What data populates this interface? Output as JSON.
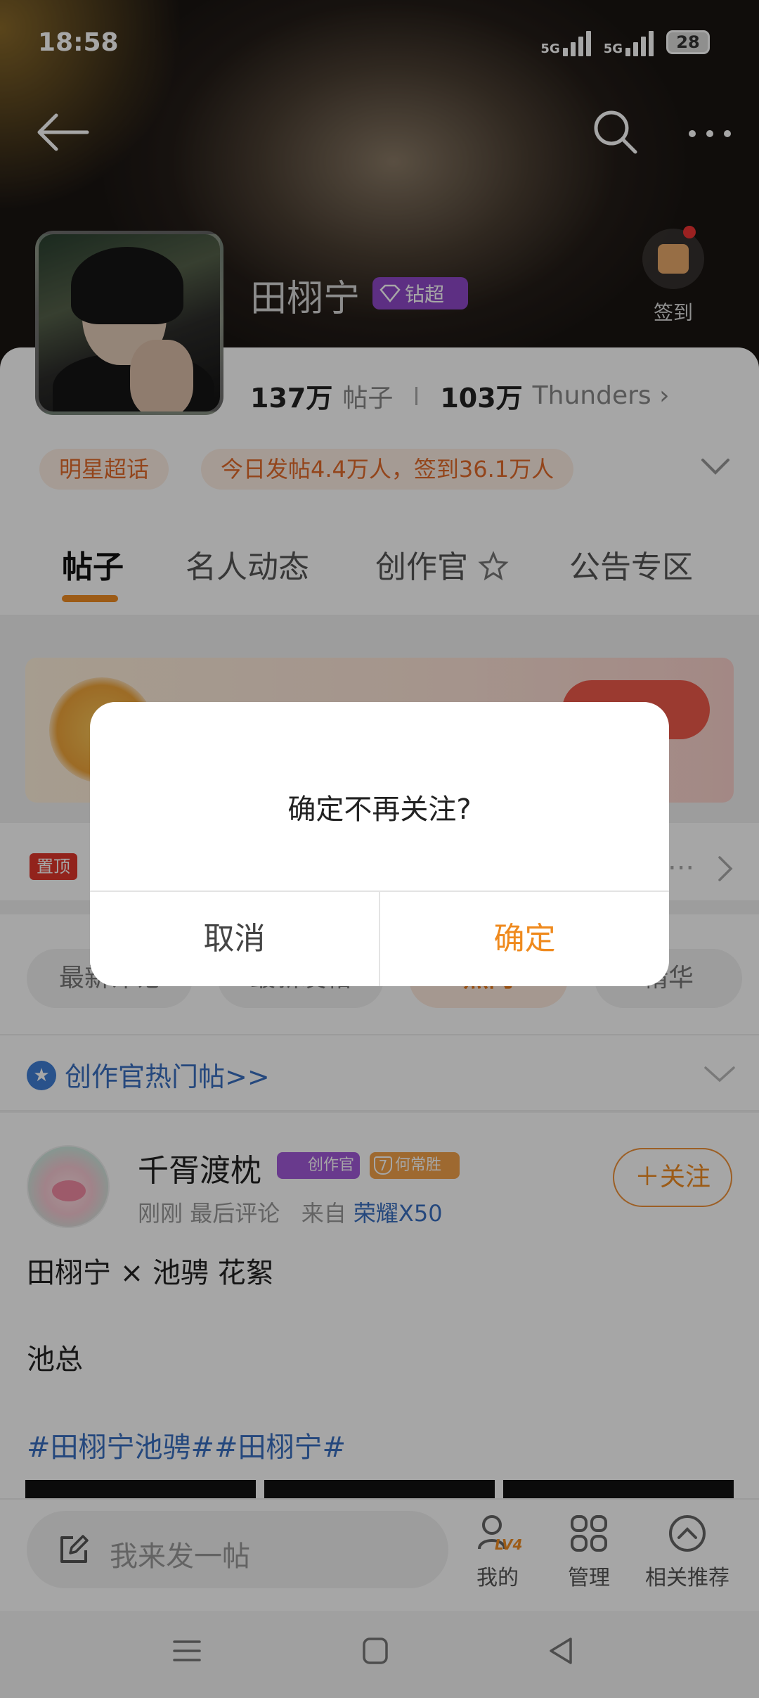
{
  "status_bar": {
    "time": "18:58",
    "net1": "5G",
    "net2": "5G",
    "battery": "28"
  },
  "header": {
    "topic_name": "田栩宁",
    "badge": "钻超",
    "checkin_label": "签到",
    "posts_count": "137万",
    "posts_label": "帖子",
    "fans_count": "103万",
    "fans_label": "Thunders",
    "category_pill": "明星超话",
    "today_stats": "今日发帖4.4万人，签到36.1万人"
  },
  "tabs": [
    {
      "label": "帖子",
      "active": true
    },
    {
      "label": "名人动态",
      "active": false
    },
    {
      "label": "创作官",
      "active": false
    },
    {
      "label": "公告专区",
      "active": false
    }
  ],
  "pinned": {
    "tag": "置顶",
    "more": "..."
  },
  "filters": [
    "最新评论",
    "最新发帖",
    "热门",
    "精华"
  ],
  "section": {
    "title": "创作官热门帖>>"
  },
  "post": {
    "author": "千胥渡枕",
    "badge_creator": "创作官",
    "fan_level": "7",
    "badge_fan": "何常胜",
    "time": "刚刚",
    "action": "最后评论",
    "from_label": "来自",
    "device": "荣耀X50",
    "follow_label": "＋关注",
    "line1": "田栩宁 × 池骋  花絮",
    "line2": "池总",
    "tags": "#田栩宁池骋##田栩宁#"
  },
  "bottom_bar": {
    "compose_placeholder": "我来发一帖",
    "mine_label": "我的",
    "manage_label": "管理",
    "recommend_label": "相关推荐",
    "level_badge": "LV4"
  },
  "dialog": {
    "message": "确定不再关注?",
    "cancel_label": "取消",
    "confirm_label": "确定"
  },
  "colors": {
    "accent": "#ef8a1e",
    "link": "#3a6fc0",
    "badge_purple": "#8f49c9"
  }
}
